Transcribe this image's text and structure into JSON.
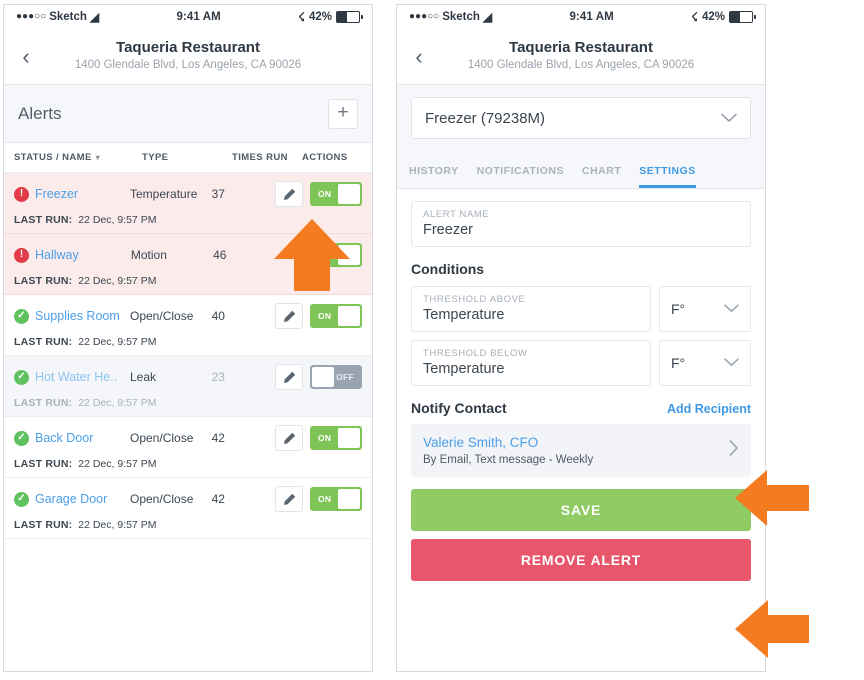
{
  "status_bar": {
    "carrier_dots": "●●●○○",
    "carrier": "Sketch",
    "wifi_icon": "wifi-icon",
    "time": "9:41 AM",
    "bluetooth_icon": "bluetooth-icon",
    "battery_percent": "42%"
  },
  "nav": {
    "back_icon": "chevron-left-icon",
    "title": "Taqueria Restaurant",
    "subtitle": "1400 Glendale Blvd, Los Angeles, CA 90026"
  },
  "left_screen": {
    "header": {
      "title": "Alerts",
      "add_label": "+"
    },
    "table": {
      "columns": {
        "status_name": "STATUS / NAME",
        "sort_caret": "▾",
        "type": "TYPE",
        "times_run": "TIMES RUN",
        "actions": "ACTIONS"
      },
      "last_run_label": "LAST RUN:",
      "rows": [
        {
          "status": "alert",
          "name": "Freezer",
          "type": "Temperature",
          "times_run": "37",
          "toggle": "ON",
          "has_edit": true,
          "last_run": "22 Dec, 9:57 PM"
        },
        {
          "status": "alert",
          "name": "Hallway",
          "type": "Motion",
          "times_run": "46",
          "toggle": "ON",
          "has_edit": false,
          "last_run": "22 Dec, 9:57 PM"
        },
        {
          "status": "ok",
          "name": "Supplies Room",
          "type": "Open/Close",
          "times_run": "40",
          "toggle": "ON",
          "has_edit": true,
          "last_run": "22 Dec, 9:57 PM"
        },
        {
          "status": "ok",
          "name": "Hot Water He..",
          "type": "Leak",
          "times_run": "23",
          "toggle": "OFF",
          "has_edit": true,
          "last_run": "22 Dec, 9:57 PM"
        },
        {
          "status": "ok",
          "name": "Back Door",
          "type": "Open/Close",
          "times_run": "42",
          "toggle": "ON",
          "has_edit": true,
          "last_run": "22 Dec, 9:57 PM"
        },
        {
          "status": "ok",
          "name": "Garage Door",
          "type": "Open/Close",
          "times_run": "42",
          "toggle": "ON",
          "has_edit": true,
          "last_run": "22 Dec, 9:57 PM"
        }
      ]
    }
  },
  "right_screen": {
    "device_select": {
      "value": "Freezer (79238M)",
      "chevron": "⌄"
    },
    "tabs": [
      {
        "label": "HISTORY",
        "active": false
      },
      {
        "label": "NOTIFICATIONS",
        "active": false
      },
      {
        "label": "CHART",
        "active": false
      },
      {
        "label": "SETTINGS",
        "active": true
      }
    ],
    "alert_name": {
      "label": "ALERT NAME",
      "value": "Freezer"
    },
    "conditions": {
      "title": "Conditions",
      "above": {
        "label": "THRESHOLD ABOVE",
        "value": "Temperature",
        "unit": "F°",
        "unit_chevron": "⌄"
      },
      "below": {
        "label": "THRESHOLD BELOW",
        "value": "Temperature",
        "unit": "F°",
        "unit_chevron": "⌄"
      }
    },
    "notify": {
      "title": "Notify Contact",
      "add_recipient": "Add Recipient",
      "contact_name": "Valerie Smith, CFO",
      "contact_meta": "By Email, Text message - Weekly",
      "chevron": "›"
    },
    "buttons": {
      "save": "SAVE",
      "remove": "REMOVE ALERT"
    }
  },
  "annotations": {
    "arrow_color": "#F47B20",
    "arrows": [
      {
        "name": "arrow-pointing-edit-pencil",
        "direction": "up"
      },
      {
        "name": "arrow-pointing-notify-contact",
        "direction": "left"
      },
      {
        "name": "arrow-pointing-remove-alert",
        "direction": "left"
      }
    ]
  },
  "colors": {
    "accent_blue": "#3F9AE5",
    "link_blue": "#4A9FE8",
    "toggle_on_green": "#7FC456",
    "toggle_off_gray": "#9AA4B1",
    "alert_red": "#E03B47",
    "ok_green": "#5FC25F",
    "save_green": "#8FCC63",
    "remove_red": "#E8566B",
    "alert_row_bg": "#FBEBEB",
    "disabled_row_bg": "#F4F6F9",
    "panel_bg": "#F5F7FA"
  }
}
